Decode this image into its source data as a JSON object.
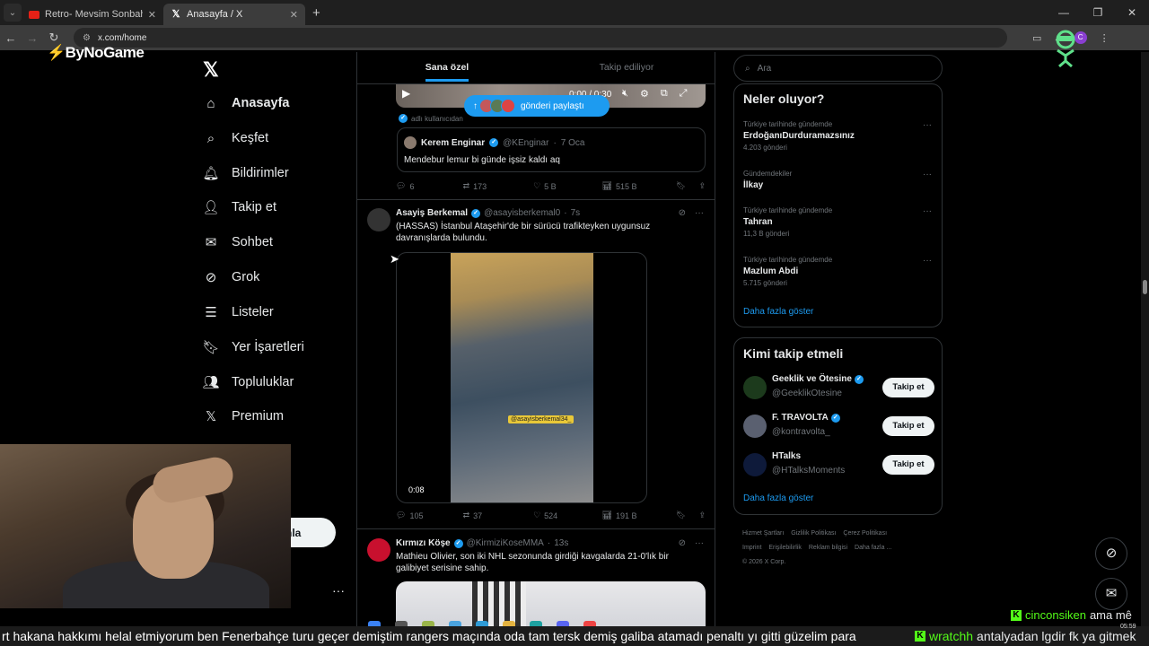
{
  "browser": {
    "tabs": [
      {
        "label": "Retro- Mevsim Sonbahar X MV",
        "icon": "youtube-icon",
        "active": false
      },
      {
        "label": "Anasayfa / X",
        "icon": "x-icon",
        "active": true
      }
    ],
    "url": "x.com/home"
  },
  "overlay": {
    "brand": "ByNoGame"
  },
  "nav": {
    "items": [
      {
        "label": "Anasayfa",
        "icon": "home-icon",
        "glyph": "⌂"
      },
      {
        "label": "Keşfet",
        "icon": "search-icon",
        "glyph": "⌕"
      },
      {
        "label": "Bildirimler",
        "icon": "bell-icon",
        "glyph": "🔔︎"
      },
      {
        "label": "Takip et",
        "icon": "add-person-icon",
        "glyph": "👤︎"
      },
      {
        "label": "Sohbet",
        "icon": "mail-icon",
        "glyph": "✉"
      },
      {
        "label": "Grok",
        "icon": "grok-icon",
        "glyph": "⊘"
      },
      {
        "label": "Listeler",
        "icon": "list-icon",
        "glyph": "☰"
      },
      {
        "label": "Yer İşaretleri",
        "icon": "bookmark-icon",
        "glyph": "🔖︎"
      },
      {
        "label": "Topluluklar",
        "icon": "communities-icon",
        "glyph": "👥︎"
      },
      {
        "label": "Premium",
        "icon": "x-premium-icon",
        "glyph": "𝕏"
      }
    ],
    "post_button": "nla"
  },
  "feed": {
    "tabs": [
      "Sana özel",
      "Takip ediliyor"
    ],
    "video_time": "0:00 / 0:30",
    "share_pill": "gönderi paylaştı",
    "note": "adlı kullanıcıdan",
    "quote": {
      "name": "Kerem Enginar",
      "handle": "@KEnginar",
      "time": "7 Oca",
      "text": "Mendebur lemur bi günde işsiz kaldı aq"
    },
    "actions1": {
      "replies": "6",
      "reposts": "173",
      "likes": "5 B",
      "views": "515 B"
    },
    "tweet1": {
      "name": "Asayiş Berkemal",
      "handle": "@asayisberkemal0",
      "time": "7s",
      "text": "(HASSAS) İstanbul Ataşehir'de bir sürücü trafikteyken uygunsuz davranışlarda bulundu.",
      "video_tag": "@asayisberkemal34_",
      "duration": "0:08"
    },
    "actions2": {
      "replies": "105",
      "reposts": "37",
      "likes": "524",
      "views": "191 B"
    },
    "tweet2": {
      "name": "Kırmızı Köşe",
      "handle": "@KirmiziKoseMMA",
      "time": "13s",
      "text": "Mathieu Olivier, son iki NHL sezonunda girdiği kavgalarda 21-0'lık bir galibiyet serisine sahip."
    }
  },
  "right": {
    "search_placeholder": "Ara",
    "trends_title": "Neler oluyor?",
    "trends": [
      {
        "context": "Türkiye tarihinde gündemde",
        "name": "ErdoğanıDurduramazsınız",
        "count": "4.203 gönderi"
      },
      {
        "context": "Gündemdekiler",
        "name": "İlkay",
        "count": ""
      },
      {
        "context": "Türkiye tarihinde gündemde",
        "name": "Tahran",
        "count": "11,3 B gönderi"
      },
      {
        "context": "Türkiye tarihinde gündemde",
        "name": "Mazlum Abdi",
        "count": "5.715 gönderi"
      }
    ],
    "show_more": "Daha fazla göster",
    "who_title": "Kimi takip etmeli",
    "who": [
      {
        "name": "Geeklik ve Ötesine",
        "handle": "@GeeklikOtesine",
        "button": "Takip et"
      },
      {
        "name": "F. TRAVOLTA",
        "handle": "@kontravolta_",
        "button": "Takip et"
      },
      {
        "name": "HTalks",
        "handle": "@HTalksMoments",
        "button": "Takip et"
      }
    ],
    "footer": [
      "Hizmet Şartları",
      "Gizlilik Politikası",
      "Çerez Politikası",
      "Imprint",
      "Erişilebilirlik",
      "Reklam bilgisi",
      "Daha fazla ...",
      "© 2026 X Corp."
    ]
  },
  "stream": {
    "chat_user": "cinconsiken",
    "chat_text": "ama mê",
    "ticker": "rt hakana hakkımı helal etmiyorum ben Fenerbahçe turu geçer demiştim rangers maçında oda tam tersk demiş galiba atamadı penaltı yı gitti güzelim para",
    "ticker_user": "wratchh",
    "ticker_text2": "antalyadan lgdir fk ya gitmek",
    "clock": "05:59"
  }
}
